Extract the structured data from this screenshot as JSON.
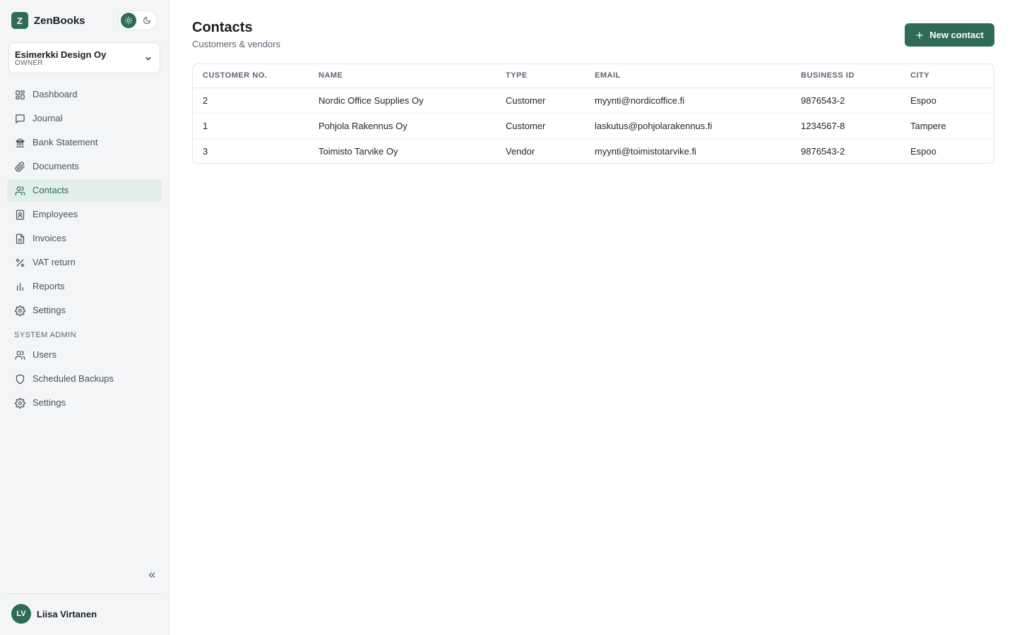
{
  "app": {
    "logo_letter": "Z",
    "name": "ZenBooks"
  },
  "theme": {
    "light_icon": "sun-icon",
    "dark_icon": "moon-icon"
  },
  "org": {
    "name": "Esimerkki Design Oy",
    "role": "OWNER"
  },
  "nav": [
    {
      "label": "Dashboard",
      "icon": "dashboard-icon"
    },
    {
      "label": "Journal",
      "icon": "journal-icon"
    },
    {
      "label": "Bank Statement",
      "icon": "bank-icon"
    },
    {
      "label": "Documents",
      "icon": "paperclip-icon"
    },
    {
      "label": "Contacts",
      "icon": "contacts-icon",
      "active": true
    },
    {
      "label": "Employees",
      "icon": "employee-badge-icon"
    },
    {
      "label": "Invoices",
      "icon": "invoice-icon"
    },
    {
      "label": "VAT return",
      "icon": "percent-icon"
    },
    {
      "label": "Reports",
      "icon": "bar-chart-icon"
    },
    {
      "label": "Settings",
      "icon": "gear-icon"
    }
  ],
  "admin": {
    "section_label": "SYSTEM ADMIN",
    "items": [
      {
        "label": "Users",
        "icon": "users-icon"
      },
      {
        "label": "Scheduled Backups",
        "icon": "shield-icon"
      },
      {
        "label": "Settings",
        "icon": "gear-icon"
      }
    ]
  },
  "user": {
    "initials": "LV",
    "name": "Liisa Virtanen"
  },
  "page": {
    "title": "Contacts",
    "subtitle": "Customers & vendors"
  },
  "actions": {
    "new_contact": "New contact"
  },
  "table": {
    "columns": [
      "CUSTOMER NO.",
      "NAME",
      "TYPE",
      "EMAIL",
      "BUSINESS ID",
      "CITY"
    ],
    "rows": [
      [
        "2",
        "Nordic Office Supplies Oy",
        "Customer",
        "myynti@nordicoffice.fi",
        "9876543-2",
        "Espoo"
      ],
      [
        "1",
        "Pohjola Rakennus Oy",
        "Customer",
        "laskutus@pohjolarakennus.fi",
        "1234567-8",
        "Tampere"
      ],
      [
        "3",
        "Toimisto Tarvike Oy",
        "Vendor",
        "myynti@toimistotarvike.fi",
        "9876543-2",
        "Espoo"
      ]
    ]
  },
  "colors": {
    "accent": "#2f6b55",
    "active_bg": "#e2efe8",
    "sidebar_bg": "#f4f5f7"
  }
}
